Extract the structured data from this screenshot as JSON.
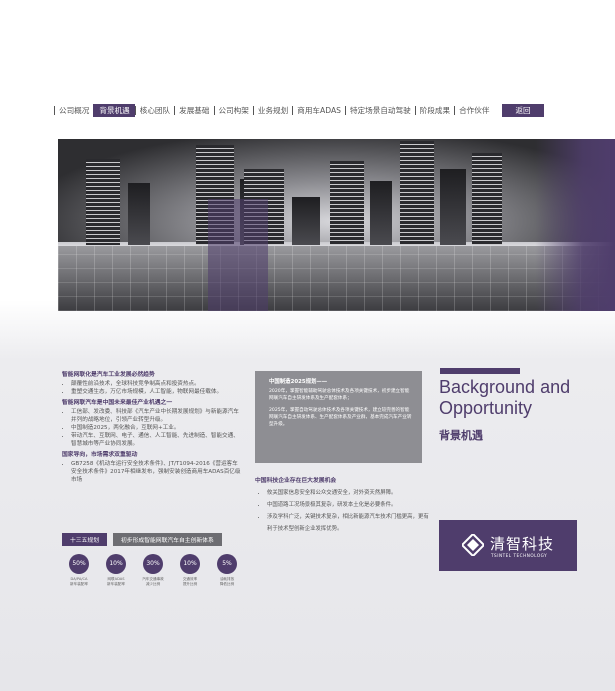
{
  "nav": {
    "items": [
      "公司概况",
      "背景机遇",
      "核心团队",
      "发展基础",
      "公司构架",
      "业务规划",
      "商用车ADAS",
      "特定场景自动驾驶",
      "阶段成果",
      "合作伙伴"
    ],
    "active_index": 1,
    "back_label": "返回"
  },
  "left": {
    "s1_title": "智能网联化是汽车工业发展必然趋势",
    "s1_items": [
      "颠覆性前沿技术，全球科技竞争制高点和投资热点。",
      "重塑交通生态，万亿市场规模，人工智能，物联网最佳载体。"
    ],
    "s2_title": "智能网联汽车是中国未来最佳产业机遇之一",
    "s2_items": [
      "工信部、发改委、科技部《汽车产业中长期发展规划》与新能源汽车并列的战略地位，引领产业转型升级。",
      "中国制造2025，两化融合，互联网+工业。",
      "带动汽车、互联网、电子、通信、人工智能、先进制造、智能交通、智慧城市等产业协同发展。"
    ],
    "s3_title": "国家导向，市场需求双重驱动",
    "s3_items": [
      "GB7258《机动车运行安全技术条件》、JT/T1094-2016《营运客车安全技术条件》2017年相继发布，强制安装创造商用车ADAS百亿级市场"
    ]
  },
  "tags": {
    "t1": "十三五规划",
    "t2": "初步形成智能网联汽车自主创新体系"
  },
  "circles": [
    {
      "value": "50%",
      "caption": "DA/PA/CA\n新车装配率"
    },
    {
      "value": "10%",
      "caption": "网联ADAS\n新车装配率"
    },
    {
      "value": "30%",
      "caption": "汽车交通事故\n减少比例"
    },
    {
      "value": "10%",
      "caption": "交通效率\n提升比例"
    },
    {
      "value": "5%",
      "caption": "油耗排放\n降低比例"
    }
  ],
  "midbox": {
    "title": "中国制造2025规划——",
    "p1": "2020年，掌握智能辅助驾驶总体技术及各项关键技术，初步建立智能网联汽车自主研发体系及生产配套体系；",
    "p2": "2025年，掌握自动驾驶总体技术及各项关键技术，建立较完善的智能网联汽车自主研发体系、生产配套体系及产业群，基本完成汽车产业转型升级。"
  },
  "mid2": {
    "title": "中国科技企业存在巨大发展机会",
    "items": [
      "攸关国家信息安全和公众交通安全，对外资天然屏障。",
      "中国道路工况场景极其复杂，研发本土化是必要条件。",
      "涉及学科广泛，关键技术复杂，相比新能源汽车技术门槛更高，更有利于技术型创新企业发挥优势。"
    ]
  },
  "right": {
    "title": "Background and Opportunity",
    "subtitle": "背景机遇"
  },
  "logo": {
    "name": "清智科技",
    "en": "TSINTEL TECHNOLOGY"
  },
  "colors": {
    "accent": "#4f3d6c",
    "gray_box": "#8e8e93"
  }
}
